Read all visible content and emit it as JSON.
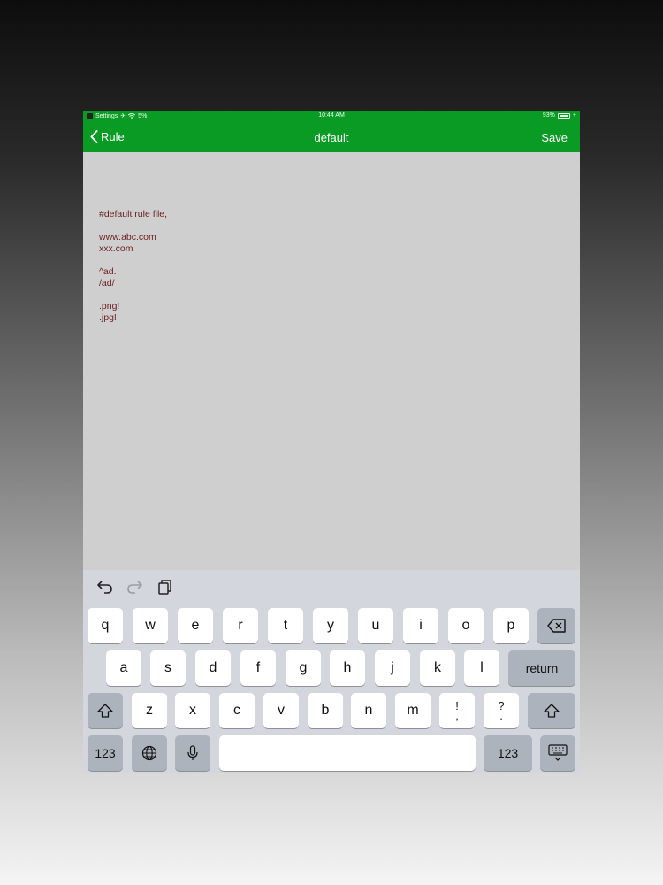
{
  "status_bar": {
    "back_app": "Settings",
    "signal": "5%",
    "time": "10:44 AM",
    "battery": "93%"
  },
  "nav": {
    "back_label": "Rule",
    "title": "default",
    "save_label": "Save"
  },
  "editor": {
    "text": "#default rule file,\n\nwww.abc.com\nxxx.com\n\n^ad.\n/ad/\n\n.png!\n.jpg!"
  },
  "keyboard": {
    "row1": [
      "q",
      "w",
      "e",
      "r",
      "t",
      "y",
      "u",
      "i",
      "o",
      "p"
    ],
    "row2": [
      "a",
      "s",
      "d",
      "f",
      "g",
      "h",
      "j",
      "k",
      "l"
    ],
    "row3": [
      "z",
      "x",
      "c",
      "v",
      "b",
      "n",
      "m"
    ],
    "punct1_top": "!",
    "punct1_bottom": ",",
    "punct2_top": "?",
    "punct2_bottom": ".",
    "return_label": "return",
    "numbers_left": "123",
    "numbers_right": "123"
  },
  "colors": {
    "nav_bar": "#0a9b25",
    "editor_bg": "#cfcfcf",
    "editor_text": "#6b1d1d",
    "keyboard_bg": "#d3d6dc"
  }
}
